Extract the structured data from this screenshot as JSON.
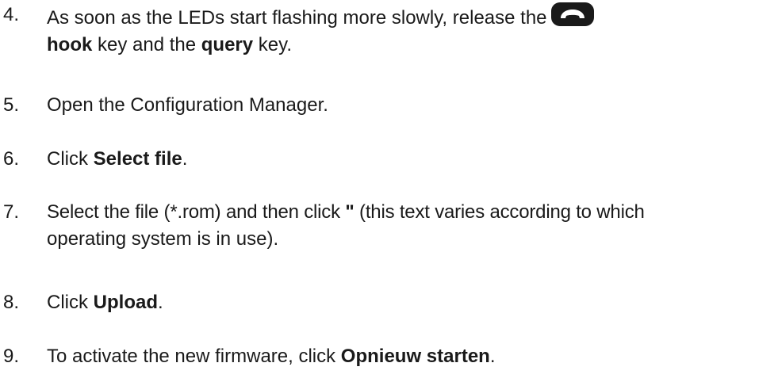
{
  "steps": [
    {
      "number": "4.",
      "line1_before": "As soon as the LEDs start flashing more slowly, release the",
      "icon": "handset-hook-icon",
      "line2_bold1": "hook",
      "line2_mid": " key and the ",
      "line2_bold2": "query",
      "line2_after": " key."
    },
    {
      "number": "5.",
      "text": "Open the Configuration Manager."
    },
    {
      "number": "6.",
      "before": "Click ",
      "bold": "Select file",
      "after": "."
    },
    {
      "number": "7.",
      "line1_before": "Select the file (*.rom) and then click ",
      "bold": "\"",
      "line1_after": " (this text varies according to which",
      "line2": "operating system is in use)."
    },
    {
      "number": "8.",
      "before": "Click ",
      "bold": "Upload",
      "after": "."
    },
    {
      "number": "9.",
      "before": "To activate the new firmware, click ",
      "bold": "Opnieuw starten",
      "after": "."
    }
  ]
}
